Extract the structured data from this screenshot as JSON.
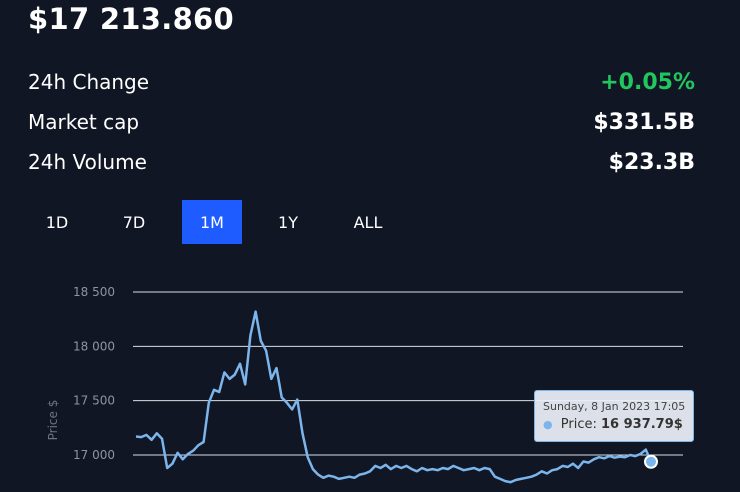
{
  "header": {
    "price": "$17 213.860"
  },
  "stats": [
    {
      "label": "24h Change",
      "value": "+0.05%",
      "trend": "positive"
    },
    {
      "label": "Market cap",
      "value": "$331.5B",
      "trend": "neutral"
    },
    {
      "label": "24h Volume",
      "value": "$23.3B",
      "trend": "neutral"
    }
  ],
  "tabs": [
    {
      "label": "1D",
      "active": false
    },
    {
      "label": "7D",
      "active": false
    },
    {
      "label": "1M",
      "active": true
    },
    {
      "label": "1Y",
      "active": false
    },
    {
      "label": "ALL",
      "active": false
    }
  ],
  "colors": {
    "background": "#101624",
    "accent": "#1e5cff",
    "positive": "#22c55e",
    "series": "#7cb5ec"
  },
  "chart_data": {
    "type": "line",
    "ylabel": "Price $",
    "yticks": [
      17000,
      17500,
      18000,
      18500
    ],
    "ytick_labels": [
      "17 000",
      "17 500",
      "18 000",
      "18 500"
    ],
    "ylim": [
      16800,
      18500
    ],
    "grid": true,
    "series": [
      {
        "values": [
          17170,
          17165,
          17185,
          17140,
          17200,
          17150,
          16880,
          16920,
          17020,
          16960,
          17010,
          17040,
          17090,
          17120,
          17480,
          17600,
          17580,
          17760,
          17700,
          17740,
          17840,
          17650,
          18100,
          18320,
          18050,
          17960,
          17700,
          17800,
          17530,
          17480,
          17420,
          17510,
          17200,
          16980,
          16870,
          16820,
          16790,
          16810,
          16800,
          16780,
          16790,
          16800,
          16790,
          16820,
          16830,
          16850,
          16900,
          16880,
          16910,
          16870,
          16900,
          16880,
          16900,
          16870,
          16850,
          16880,
          16860,
          16870,
          16860,
          16880,
          16870,
          16900,
          16880,
          16860,
          16870,
          16880,
          16860,
          16880,
          16870,
          16800,
          16780,
          16760,
          16750,
          16770,
          16780,
          16790,
          16800,
          16820,
          16850,
          16830,
          16860,
          16870,
          16900,
          16890,
          16920,
          16880,
          16940,
          16930,
          16960,
          16980,
          16970,
          16990,
          16975,
          16985,
          16980,
          17000,
          16990,
          17010,
          17050,
          16937.79
        ],
        "color": "#7cb5ec"
      }
    ]
  },
  "tooltip": {
    "date": "Sunday, 8 Jan 2023 17:05",
    "label": "Price:",
    "value": "16 937.79$"
  }
}
